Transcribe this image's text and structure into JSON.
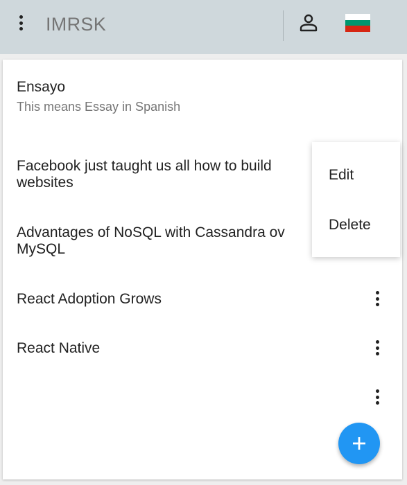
{
  "app_bar": {
    "title": "IMRSK",
    "menu_icon": "more-vertical-icon",
    "account_icon": "person-outline-icon",
    "flag_icon": "bulgaria-flag-icon",
    "background": "#cfd8dc",
    "flag_colors": [
      "#ffffff",
      "#00966e",
      "#d62612"
    ]
  },
  "list": {
    "items": [
      {
        "title": "Ensayo",
        "subtitle": "This means Essay in Spanish"
      },
      {
        "title": "Facebook just taught us all how to build",
        "title_line2": "websites"
      },
      {
        "title": "Advantages of NoSQL with Cassandra ov",
        "title_line2": "MySQL"
      },
      {
        "title": "React Adoption Grows"
      },
      {
        "title": "React Native"
      },
      {
        "title": ""
      }
    ],
    "more_icon": "more-vertical-icon"
  },
  "context_menu": {
    "edit_label": "Edit",
    "delete_label": "Delete"
  },
  "fab": {
    "icon": "plus-icon",
    "color": "#2196f3"
  }
}
